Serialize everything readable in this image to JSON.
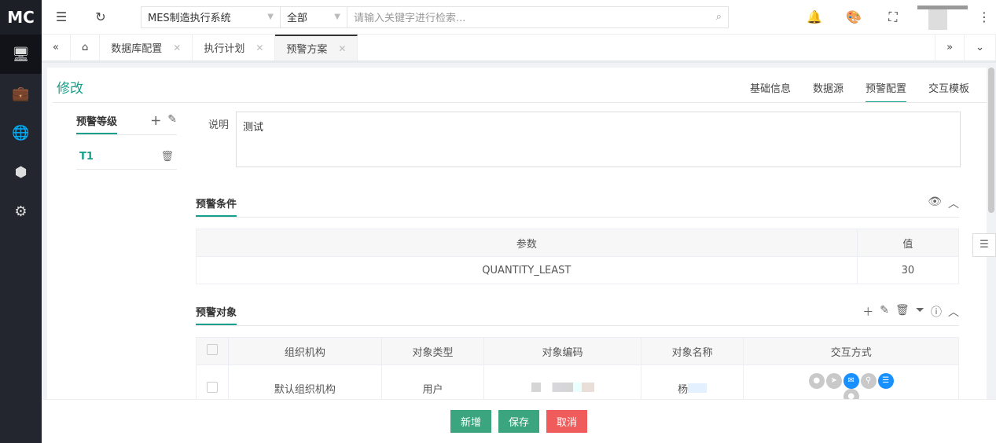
{
  "logo": "MC",
  "topbar": {
    "system": "MES制造执行系统",
    "scope": "全部",
    "search_placeholder": "请输入关键字进行检索..."
  },
  "tabs": [
    {
      "label": "数据库配置"
    },
    {
      "label": "执行计划"
    },
    {
      "label": "预警方案",
      "active": true
    }
  ],
  "page": {
    "title": "修改",
    "right_tabs": [
      "基础信息",
      "数据源",
      "预警配置",
      "交互模板"
    ],
    "active_tab": "预警配置"
  },
  "levels": {
    "header": "预警等级",
    "items": [
      "T1"
    ]
  },
  "description": {
    "label": "说明",
    "value": "测试"
  },
  "conditions": {
    "title": "预警条件",
    "columns": [
      "参数",
      "值"
    ],
    "rows": [
      [
        "QUANTITY_LEAST",
        "30"
      ]
    ]
  },
  "targets": {
    "title": "预警对象",
    "columns": [
      "组织机构",
      "对象类型",
      "对象编码",
      "对象名称",
      "交互方式"
    ],
    "rows": [
      {
        "org": "默认组织机构",
        "type": "用户",
        "code": "",
        "name": "杨"
      }
    ]
  },
  "footer": {
    "add": "新增",
    "save": "保存",
    "cancel": "取消"
  },
  "colors": {
    "accent": "#16a08b",
    "save": "#3aa57f",
    "cancel": "#f05b5b",
    "sidebar": "#23262e",
    "active_channel": "#1890ff"
  }
}
